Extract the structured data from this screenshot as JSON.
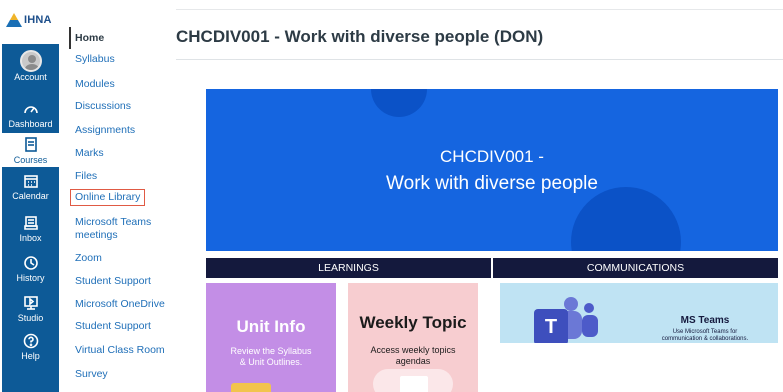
{
  "brand": {
    "logo_text": "IHNA"
  },
  "global_nav": {
    "items": [
      {
        "label": "Account",
        "icon": "account-avatar"
      },
      {
        "label": "Dashboard",
        "icon": "dashboard-icon"
      },
      {
        "label": "Courses",
        "icon": "courses-icon"
      },
      {
        "label": "Calendar",
        "icon": "calendar-icon"
      },
      {
        "label": "Inbox",
        "icon": "inbox-icon"
      },
      {
        "label": "History",
        "icon": "history-icon"
      },
      {
        "label": "Studio",
        "icon": "studio-icon"
      },
      {
        "label": "Help",
        "icon": "help-icon"
      }
    ],
    "active": "Courses"
  },
  "course_nav": {
    "items": [
      {
        "label": "Home"
      },
      {
        "label": "Syllabus"
      },
      {
        "label": "Modules"
      },
      {
        "label": "Discussions"
      },
      {
        "label": "Assignments"
      },
      {
        "label": "Marks"
      },
      {
        "label": "Files"
      },
      {
        "label": "Online Library"
      },
      {
        "label": "Microsoft Teams meetings"
      },
      {
        "label": "Zoom"
      },
      {
        "label": "Student Support"
      },
      {
        "label": "Microsoft OneDrive"
      },
      {
        "label": "Student Support"
      },
      {
        "label": "Virtual Class Room"
      },
      {
        "label": "Survey"
      }
    ],
    "current": "Home",
    "highlighted": "Online Library"
  },
  "page": {
    "title": "CHCDIV001 - Work with diverse people (DON)"
  },
  "banner": {
    "line1": "CHCDIV001 -",
    "line2": "Work with diverse people",
    "color": "#1565e0"
  },
  "sections": {
    "learnings": "LEARNINGS",
    "communications": "COMMUNICATIONS"
  },
  "cards": {
    "unit_info": {
      "title": "Unit Info",
      "subtitle_line1": "Review the Syllabus",
      "subtitle_line2": "& Unit Outlines."
    },
    "weekly_topic": {
      "title": "Weekly Topic",
      "subtitle_line1": "Access weekly topics",
      "subtitle_line2": "agendas"
    },
    "ms_teams": {
      "title": "MS Teams",
      "subtitle_line1": "Use Microsoft Teams for",
      "subtitle_line2": "communication & collaborations.",
      "logo_letter": "T"
    }
  },
  "colors": {
    "nav_blue": "#0d5a97",
    "link_blue": "#1f6fb8",
    "highlight_red": "#e05a44",
    "section_navy": "#14193d"
  }
}
